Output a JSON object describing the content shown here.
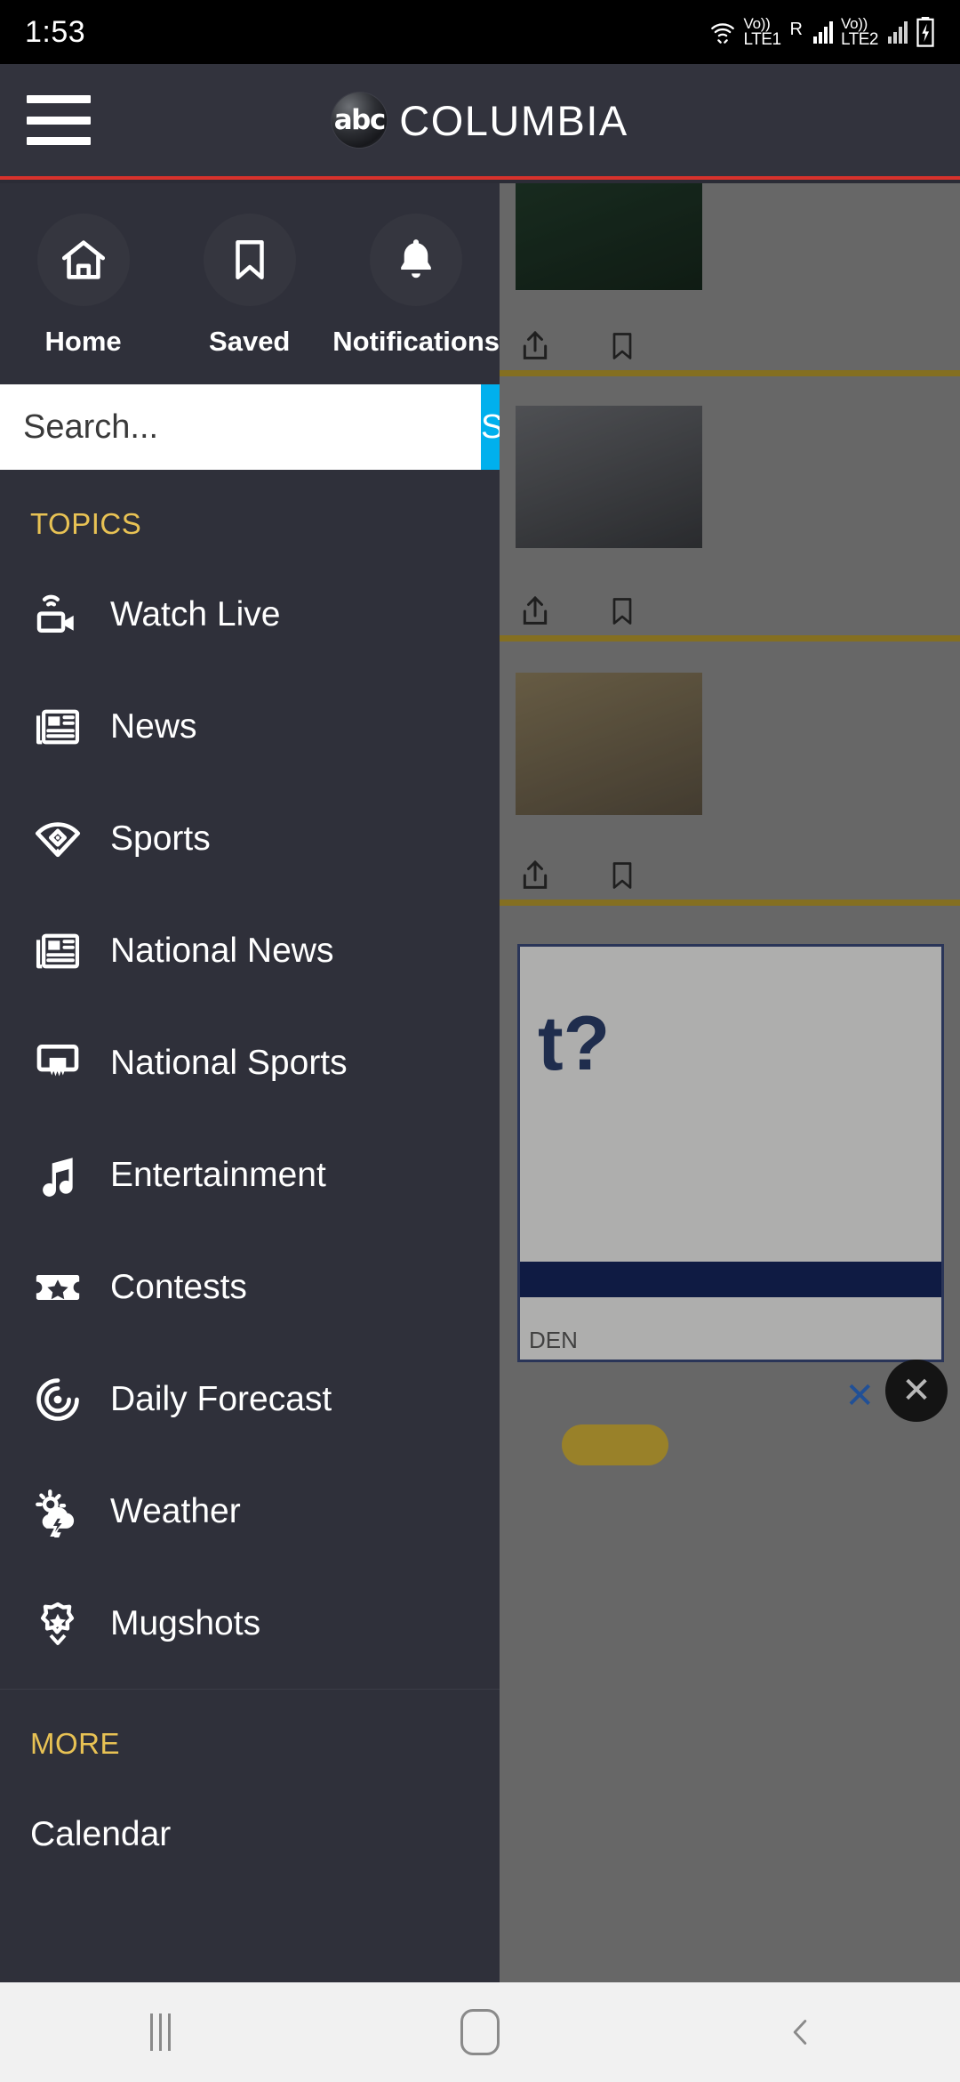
{
  "status_bar": {
    "time": "1:53",
    "icons": [
      "wifi-icon",
      "volte-lte1-icon",
      "roaming-icon",
      "signal-bars-icon",
      "volte-lte2-icon",
      "signal-bars-2-icon",
      "battery-charging-icon"
    ],
    "sim1_label": "LTE1",
    "sim2_label": "LTE2",
    "volte_label": "Vo))",
    "roaming_label": "R"
  },
  "header": {
    "menu_icon": "hamburger-icon",
    "logo_mark": "abc",
    "logo_text": "COLUMBIA",
    "accent_rule_color": "#d8322c"
  },
  "drawer": {
    "quick_nav": [
      {
        "label": "Home",
        "icon": "home-icon"
      },
      {
        "label": "Saved",
        "icon": "bookmark-icon"
      },
      {
        "label": "Notifications",
        "icon": "bell-icon"
      }
    ],
    "search": {
      "placeholder": "Search...",
      "value": "",
      "button_label": "Search",
      "button_color": "#00b0ed"
    },
    "sections": [
      {
        "title": "TOPICS",
        "title_color": "#e8c254",
        "items": [
          {
            "label": "Watch Live",
            "icon": "video-broadcast-icon"
          },
          {
            "label": "News",
            "icon": "newspaper-icon"
          },
          {
            "label": "Sports",
            "icon": "baseball-field-icon"
          },
          {
            "label": "National News",
            "icon": "newspaper-icon"
          },
          {
            "label": "National Sports",
            "icon": "basketball-hoop-icon"
          },
          {
            "label": "Entertainment",
            "icon": "music-note-icon"
          },
          {
            "label": "Contests",
            "icon": "ticket-star-icon"
          },
          {
            "label": "Daily Forecast",
            "icon": "radar-icon"
          },
          {
            "label": "Weather",
            "icon": "sun-cloud-lightning-icon"
          },
          {
            "label": "Mugshots",
            "icon": "police-badge-icon"
          }
        ]
      },
      {
        "title": "MORE",
        "title_color": "#e8c254",
        "items": [
          {
            "label": "Calendar",
            "icon": ""
          }
        ]
      }
    ]
  },
  "navigation_bar": {
    "recents_label": "recent-apps",
    "home_label": "home",
    "back_label": "back"
  }
}
